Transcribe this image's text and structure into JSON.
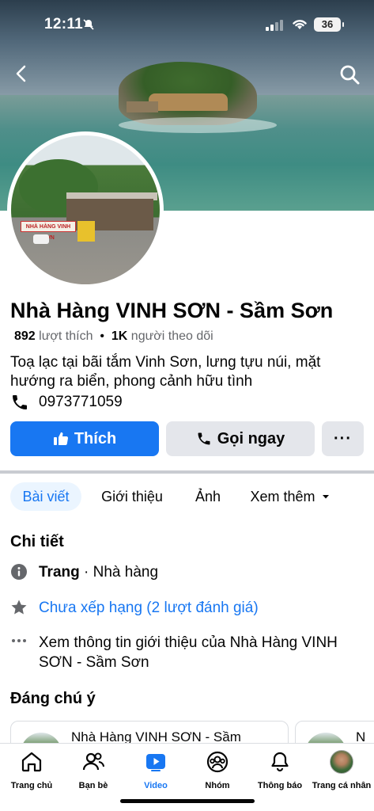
{
  "status_bar": {
    "time": "12:11",
    "battery": "36"
  },
  "page": {
    "name": "Nhà Hàng VINH SƠN - Sầm Sơn",
    "likes_count": "892",
    "likes_label": "lượt thích",
    "followers_count": "1K",
    "followers_label": "người theo dõi",
    "bio": "Toạ lạc tại bãi tắm Vinh Sơn, lưng tựu núi, mặt hướng ra biển, phong cảnh hữu tình",
    "phone": "0973771059",
    "avatar_sign_text": "NHÀ HÀNG VINH SƠN"
  },
  "actions": {
    "like": "Thích",
    "call": "Gọi ngay",
    "more": "···"
  },
  "tabs": {
    "posts": "Bài viết",
    "about": "Giới thiệu",
    "photos": "Ảnh",
    "more": "Xem thêm"
  },
  "details": {
    "title": "Chi tiết",
    "category_type": "Trang",
    "category_name": " · Nhà hàng",
    "rating": "Chưa xếp hạng (2 lượt đánh giá)",
    "see_about": "Xem thông tin giới thiệu của Nhà Hàng VINH SƠN - Sầm Sơn"
  },
  "notable": {
    "title": "Đáng chú ý",
    "card1_name": "Nhà Hàng VINH SƠN - Sầm",
    "card2_name": "N"
  },
  "bottom_nav": {
    "home": "Trang chủ",
    "friends": "Bạn bè",
    "video": "Video",
    "groups": "Nhóm",
    "notifications": "Thông báo",
    "profile": "Trang cá nhân"
  },
  "colors": {
    "accent": "#1877f2",
    "secondary_button": "#e4e6eb",
    "muted_text": "#65676b"
  }
}
